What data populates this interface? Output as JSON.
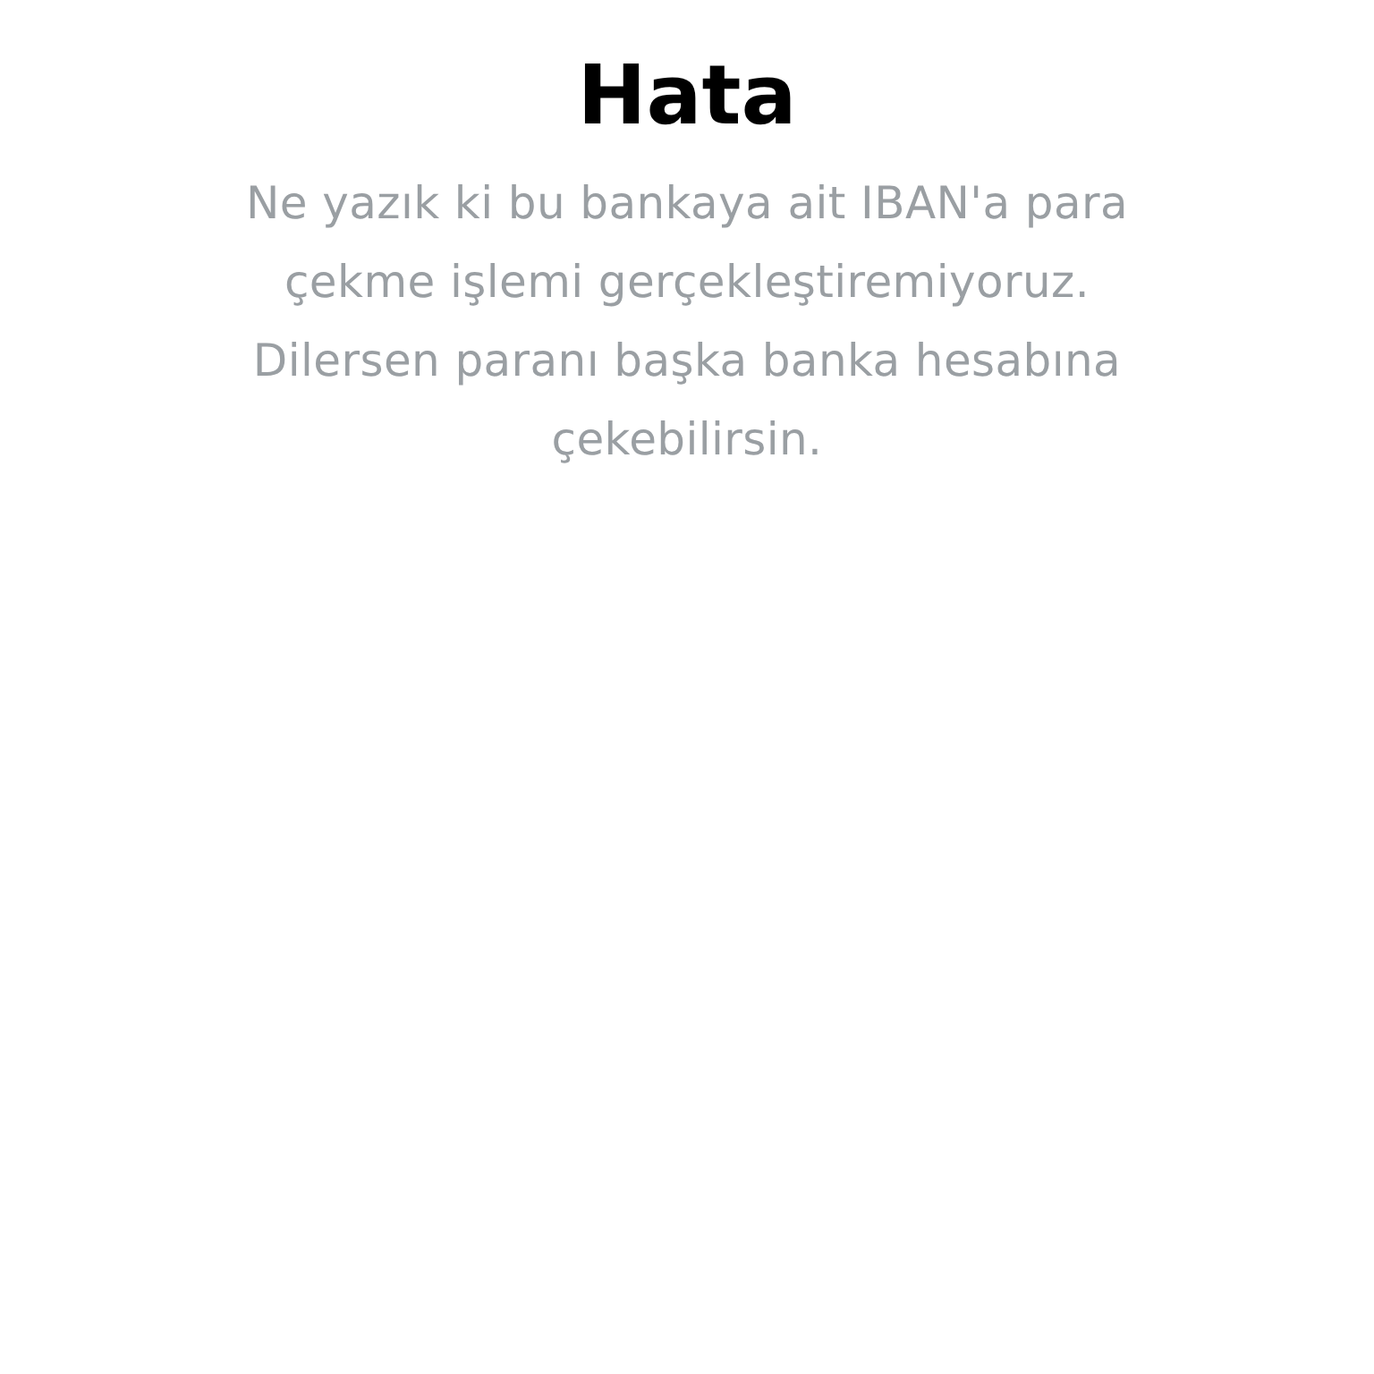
{
  "title": "Hata",
  "message_lines": [
    "Ne yazık ki bu bankaya ait IBAN'a para",
    "çekme işlemi gerçekleştiremiyoruz.",
    "Dilersen paranı başka banka hesabına",
    "çekebilirsin."
  ]
}
